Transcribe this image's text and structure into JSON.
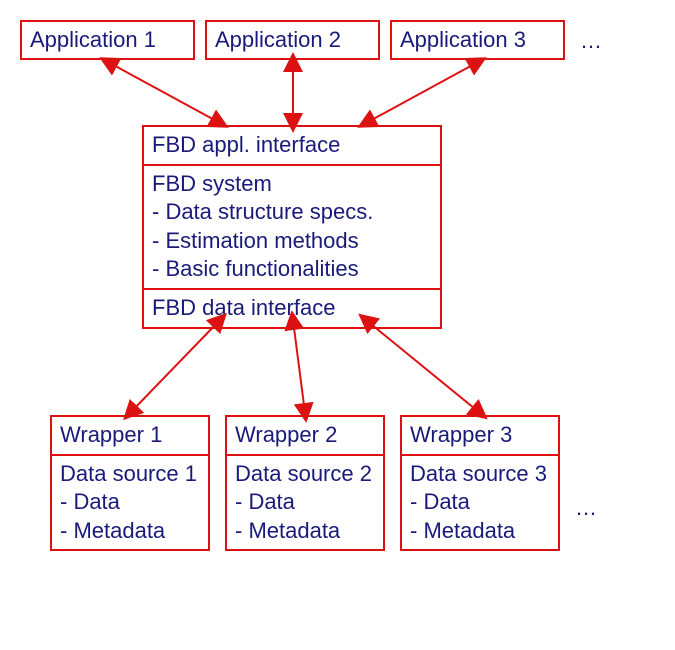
{
  "applications": [
    {
      "label": "Application 1"
    },
    {
      "label": "Application 2"
    },
    {
      "label": "Application 3"
    }
  ],
  "applications_ellipsis": "…",
  "core": {
    "appl_interface": "FBD appl. interface",
    "system_title": "FBD system",
    "system_items": [
      "- Data structure specs.",
      "- Estimation methods",
      "- Basic functionalities"
    ],
    "data_interface": "FBD data interface"
  },
  "wrappers": [
    {
      "title": "Wrapper 1",
      "source": "Data source 1",
      "items": [
        "- Data",
        "- Metadata"
      ]
    },
    {
      "title": "Wrapper 2",
      "source": "Data source 2",
      "items": [
        "- Data",
        "- Metadata"
      ]
    },
    {
      "title": "Wrapper 3",
      "source": "Data source 3",
      "items": [
        "- Data",
        "- Metadata"
      ]
    }
  ],
  "wrappers_ellipsis": "…"
}
